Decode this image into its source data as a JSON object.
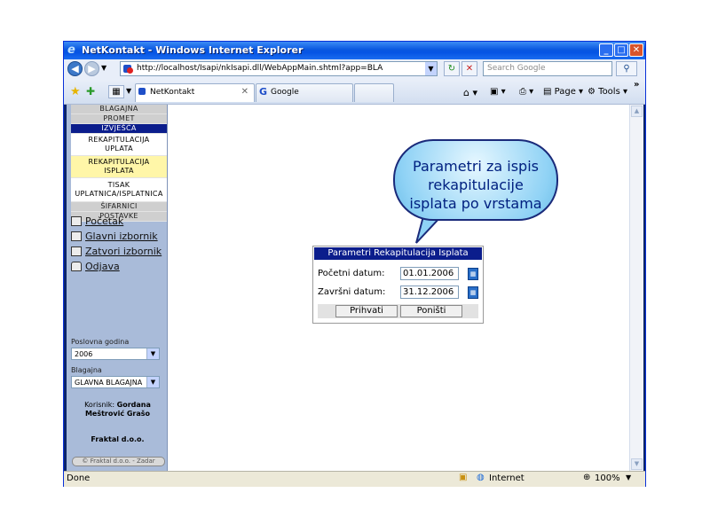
{
  "window": {
    "title": "NetKontakt - Windows Internet Explorer"
  },
  "browser": {
    "url": "http://localhost/Isapi/nkIsapi.dll/WebAppMain.shtml?app=BLA",
    "search_placeholder": "Search Google",
    "tabs": [
      {
        "label": "NetKontakt"
      },
      {
        "label": "Google"
      }
    ],
    "tools": {
      "page": "Page",
      "tools": "Tools"
    }
  },
  "sidebar": {
    "menu": [
      {
        "label": "BLAGAJNA",
        "style": "grey"
      },
      {
        "label": "PROMET",
        "style": "grey"
      },
      {
        "label": "IZVJEŠĆA",
        "style": "blue"
      },
      {
        "label": "REKAPITULACIJA UPLATA",
        "style": "white"
      },
      {
        "label": "REKAPITULACIJA ISPLATA",
        "style": "yellow"
      },
      {
        "label": "TISAK UPLATNICA/ISPLATNICA",
        "style": "white"
      },
      {
        "label": "ŠIFARNICI",
        "style": "grey"
      },
      {
        "label": "POSTAVKE",
        "style": "grey"
      }
    ],
    "links": [
      {
        "label": "Početak",
        "icon": "home-icon"
      },
      {
        "label": "Glavni izbornik",
        "icon": "menu-icon"
      },
      {
        "label": "Zatvori izbornik",
        "icon": "close-menu-icon"
      },
      {
        "label": "Odjava",
        "icon": "lock-icon"
      }
    ],
    "year_label": "Poslovna godina",
    "year_value": "2006",
    "cashbox_label": "Blagajna",
    "cashbox_value": "GLAVNA BLAGAJNA",
    "user_prefix": "Korisnik:",
    "user_first": "Gordana",
    "user_last": "Meštrović Grašo",
    "company": "Fraktal d.o.o.",
    "footer": "© Fraktal d.o.o. - Zadar"
  },
  "callout": {
    "lines": [
      "Parametri za ispis",
      "rekapitulacije",
      "isplata po vrstama"
    ]
  },
  "dialog": {
    "title": "Parametri Rekapitulacija Isplata",
    "start_label": "Početni datum:",
    "start_value": "01.01.2006",
    "end_label": "Završni datum:",
    "end_value": "31.12.2006",
    "ok_label": "Prihvati",
    "cancel_label": "Poništi"
  },
  "status": {
    "left": "Done",
    "zone": "Internet",
    "zoom": "100%"
  },
  "colors": {
    "title_bar": "#0554e3",
    "menu_active": "#0b1d8c",
    "menu_highlight": "#fff6a8",
    "sidebar_bg": "#a9bbd9"
  }
}
